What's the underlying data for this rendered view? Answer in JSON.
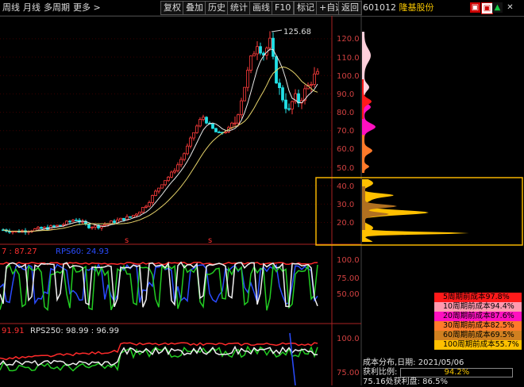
{
  "toolbar": {
    "items": [
      "周线",
      "月线",
      "多周期",
      "更多 >",
      "复权",
      "叠加",
      "历史",
      "统计",
      "画线",
      "F10",
      "标记",
      "+自选",
      "返回"
    ],
    "stock_code": "601012",
    "stock_name": "隆基股份"
  },
  "main_chart": {
    "y_ticks": [
      "120.0",
      "110.0",
      "100.0",
      "90.0",
      "80.0",
      "70.0",
      "60.0",
      "50.0",
      "40.0",
      "30.0",
      "20.0"
    ],
    "high_label": "125.68",
    "markers": [
      "s",
      "s"
    ]
  },
  "rps1": {
    "header_a": "7 : 87.27",
    "header_b": "RPS60: 24.93",
    "y_ticks": [
      "100.0",
      "75.00",
      "50.00"
    ]
  },
  "rps2": {
    "header_a": "91.91",
    "header_b": "RPS250: 98.99 : 96.99",
    "y_ticks": [
      "100.0",
      "75.00"
    ]
  },
  "legend": [
    {
      "label": "5周期前成本97.8%",
      "color": "#ff1a1a"
    },
    {
      "label": "10周期前成本94.4%",
      "color": "#ff9ab0"
    },
    {
      "label": "20周期前成本87.6%",
      "color": "#ff10c0"
    },
    {
      "label": "30周期前成本82.5%",
      "color": "#ff7a2a"
    },
    {
      "label": "60周期前成本69.5%",
      "color": "#d08020"
    },
    {
      "label": "100周期前成本55.7%",
      "color": "#ffc000"
    }
  ],
  "info": {
    "dist_label": "成本分布,日期:",
    "date": "2021/05/06",
    "profit_label": "获利比例:",
    "profit_value": "94.2%",
    "extra": "75.16处获利盘: 86.5%"
  }
}
